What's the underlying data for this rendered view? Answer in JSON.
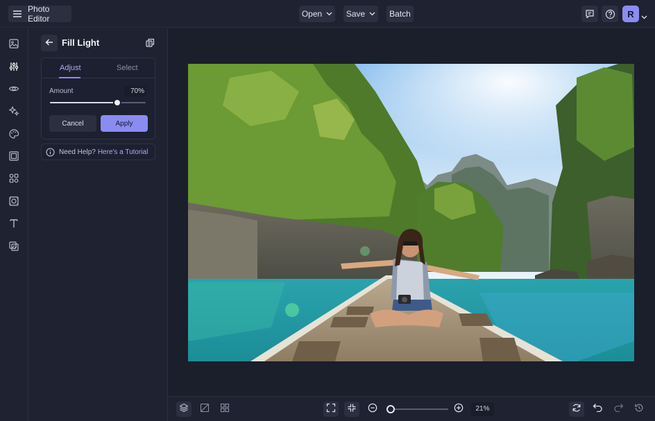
{
  "app": {
    "title": "Photo Editor"
  },
  "toolbar": {
    "open_label": "Open",
    "save_label": "Save",
    "batch_label": "Batch",
    "avatar_initial": "R"
  },
  "rail": {
    "items": [
      {
        "icon": "image-icon"
      },
      {
        "icon": "sliders-icon",
        "active": true
      },
      {
        "icon": "eye-icon"
      },
      {
        "icon": "sparkle-effects-icon"
      },
      {
        "icon": "palette-icon"
      },
      {
        "icon": "frame-icon"
      },
      {
        "icon": "graphics-icon"
      },
      {
        "icon": "overlay-icon"
      },
      {
        "icon": "text-icon"
      },
      {
        "icon": "texture-icon"
      }
    ]
  },
  "panel": {
    "title": "Fill Light",
    "tabs": [
      {
        "label": "Adjust",
        "active": true
      },
      {
        "label": "Select",
        "active": false
      }
    ],
    "amount_label": "Amount",
    "amount_value": "70%",
    "amount_fraction": 0.7,
    "cancel_label": "Cancel",
    "apply_label": "Apply",
    "help_text": "Need Help?",
    "help_link": "Here's a Tutorial"
  },
  "bottom": {
    "zoom_value": "21%",
    "zoom_fraction": 0.03
  },
  "colors": {
    "accent": "#8a8cf2",
    "background": "#1b1e2b",
    "panel": "#1f2230",
    "button": "#2b2f40"
  }
}
